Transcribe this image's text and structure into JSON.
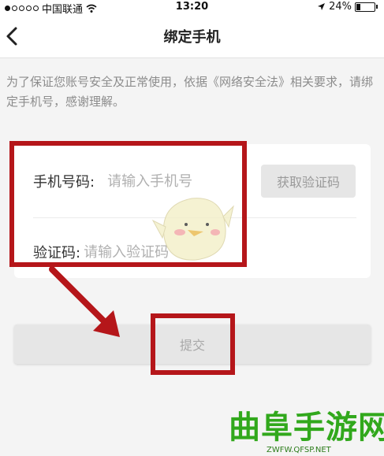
{
  "status_bar": {
    "carrier": "中国联通",
    "time": "13:20",
    "battery": "24%",
    "battery_level": 0.24
  },
  "nav": {
    "title": "绑定手机"
  },
  "notice": "为了保证您账号安全及正常使用，依据《网络安全法》相关要求，请绑定手机号，感谢理解。",
  "form": {
    "phone_label": "手机号码:",
    "phone_placeholder": "请输入手机号",
    "get_code_button": "获取验证码",
    "code_label": "验证码:",
    "code_placeholder": "请输入验证码"
  },
  "submit_button": "提交",
  "watermark": {
    "title": "曲阜手游网",
    "url": "ZWFW.QFSP.NET"
  },
  "colors": {
    "annotation_red": "#b5161a",
    "watermark_green": "#31a81c"
  }
}
